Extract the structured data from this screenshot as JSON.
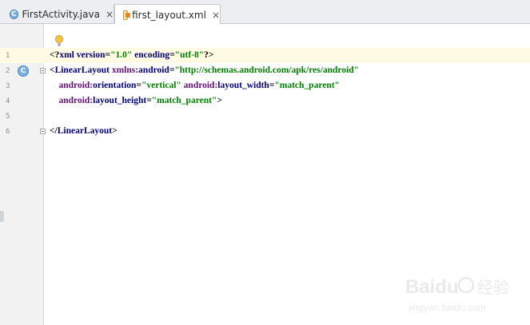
{
  "tabs": [
    {
      "label": "FirstActivity.java",
      "icon": "java-class-icon",
      "close": "×"
    },
    {
      "label": "first_layout.xml",
      "icon": "xml-file-icon",
      "close": "×",
      "active": true
    }
  ],
  "gutter": {
    "line_numbers": [
      "1",
      "2",
      "3",
      "4",
      "5",
      "6"
    ],
    "class_marker": "C"
  },
  "code_lines": [
    {
      "parts": [
        [
          "plain",
          "<?"
        ],
        [
          "tag",
          "xml version"
        ],
        [
          "plain",
          "="
        ],
        [
          "str",
          "\"1.0\""
        ],
        [
          "plain",
          " "
        ],
        [
          "tag",
          "encoding"
        ],
        [
          "plain",
          "="
        ],
        [
          "str",
          "\"utf-8\""
        ],
        [
          "plain",
          "?>"
        ]
      ]
    },
    {
      "parts": [
        [
          "plain",
          "<"
        ],
        [
          "tag",
          "LinearLayout "
        ],
        [
          "ns",
          "xmlns:"
        ],
        [
          "tag",
          "android"
        ],
        [
          "plain",
          "="
        ],
        [
          "str",
          "\"http://schemas.android.com/apk/res/android\""
        ]
      ]
    },
    {
      "parts": [
        [
          "plain",
          "    "
        ],
        [
          "ns",
          "android:"
        ],
        [
          "attr",
          "orientation"
        ],
        [
          "plain",
          "="
        ],
        [
          "str",
          "\"vertical\""
        ],
        [
          "plain",
          " "
        ],
        [
          "ns",
          "android:"
        ],
        [
          "attr",
          "layout_width"
        ],
        [
          "plain",
          "="
        ],
        [
          "str",
          "\"match_parent\""
        ]
      ]
    },
    {
      "parts": [
        [
          "plain",
          "    "
        ],
        [
          "ns",
          "android:"
        ],
        [
          "attr",
          "layout_height"
        ],
        [
          "plain",
          "="
        ],
        [
          "str",
          "\"match_parent\""
        ],
        [
          "plain",
          ">"
        ]
      ]
    },
    {
      "parts": []
    },
    {
      "parts": [
        [
          "plain",
          "</"
        ],
        [
          "tag",
          "LinearLayout"
        ],
        [
          "plain",
          ">"
        ]
      ]
    }
  ],
  "watermark": {
    "brand": "Baidu",
    "sub": "经验",
    "url": "jingyan.baidu.com"
  },
  "colors": {
    "tag": "#000080",
    "namespace": "#660e7a",
    "string": "#008000",
    "current_line": "#fffae3"
  }
}
